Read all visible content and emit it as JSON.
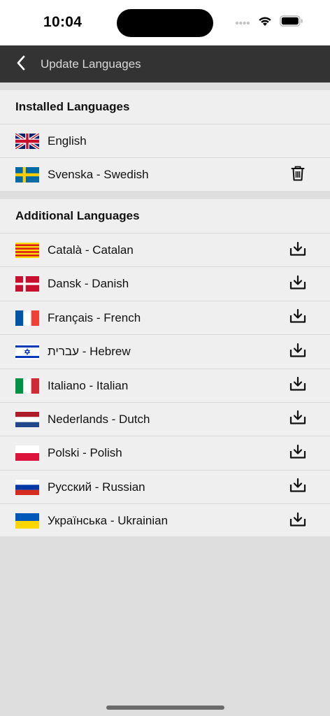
{
  "status_bar": {
    "time": "10:04"
  },
  "nav": {
    "title": "Update Languages",
    "back_icon": "chevron-left-icon"
  },
  "installed": {
    "header": "Installed Languages",
    "items": [
      {
        "label": "English",
        "flag": "uk-flag",
        "action": "none"
      },
      {
        "label": "Svenska - Swedish",
        "flag": "sweden-flag",
        "action": "trash-icon"
      }
    ]
  },
  "additional": {
    "header": "Additional Languages",
    "items": [
      {
        "label": "Català - Catalan",
        "flag": "catalonia-flag",
        "action": "download-icon"
      },
      {
        "label": "Dansk - Danish",
        "flag": "denmark-flag",
        "action": "download-icon"
      },
      {
        "label": "Français - French",
        "flag": "france-flag",
        "action": "download-icon"
      },
      {
        "label": "עברית - Hebrew",
        "flag": "israel-flag",
        "action": "download-icon"
      },
      {
        "label": "Italiano - Italian",
        "flag": "italy-flag",
        "action": "download-icon"
      },
      {
        "label": "Nederlands - Dutch",
        "flag": "netherlands-flag",
        "action": "download-icon"
      },
      {
        "label": "Polski - Polish",
        "flag": "poland-flag",
        "action": "download-icon"
      },
      {
        "label": "Русский - Russian",
        "flag": "russia-flag",
        "action": "download-icon"
      },
      {
        "label": "Українська - Ukrainian",
        "flag": "ukraine-flag",
        "action": "download-icon"
      }
    ]
  },
  "colors": {
    "nav_bg": "#333333",
    "nav_text": "#d8d8d8",
    "section_bg": "#efefef",
    "page_bg": "#dedede"
  }
}
